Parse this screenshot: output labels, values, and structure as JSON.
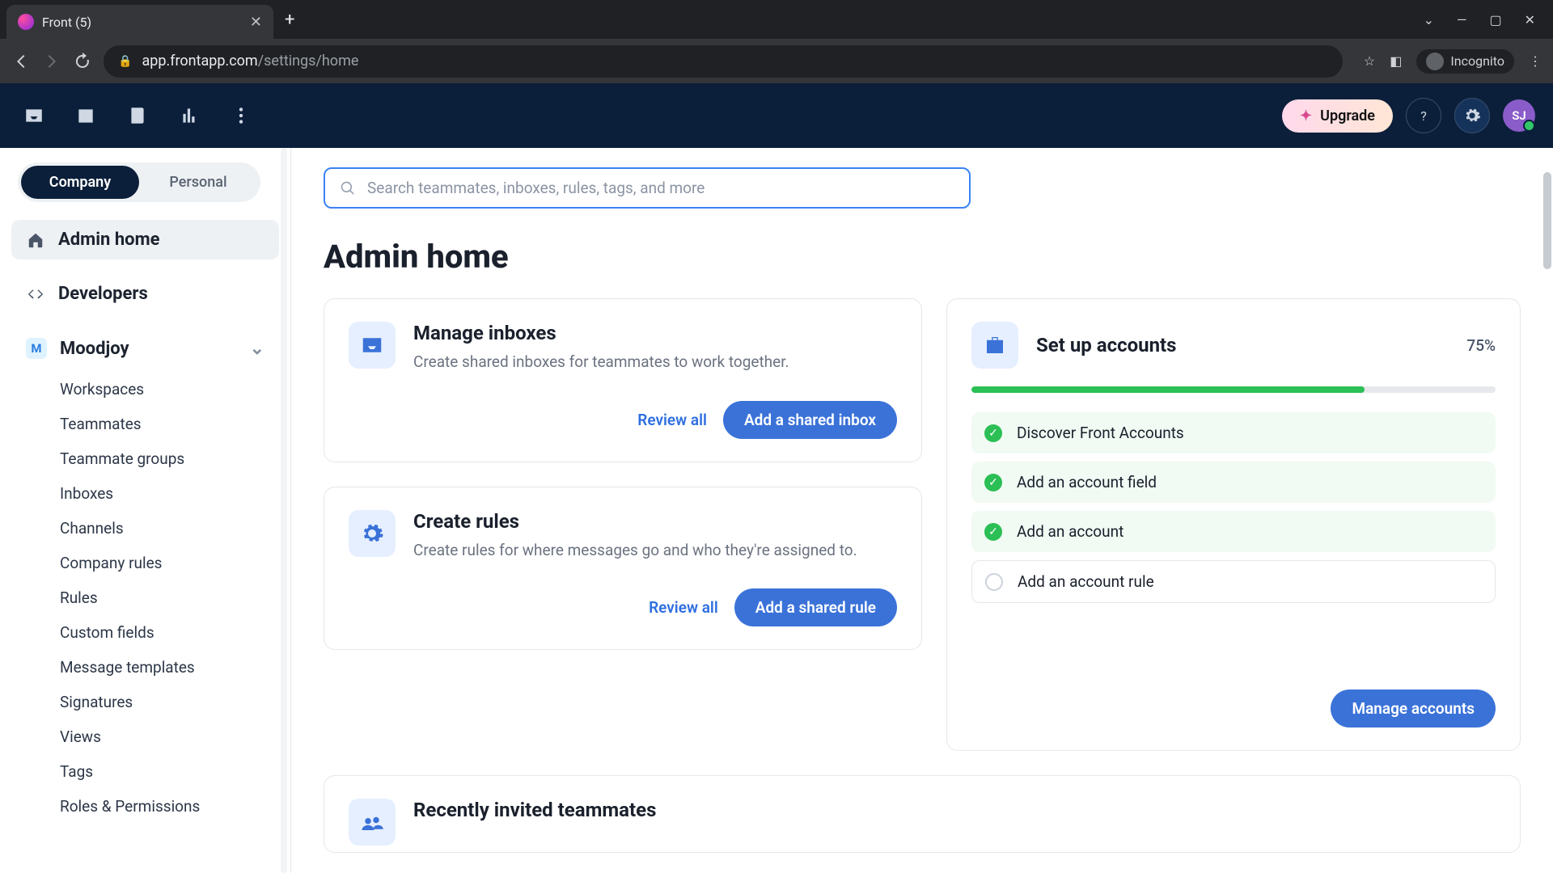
{
  "browser": {
    "tab_title": "Front (5)",
    "url_domain": "app.frontapp.com",
    "url_path": "/settings/home",
    "incognito_label": "Incognito"
  },
  "topbar": {
    "upgrade_label": "Upgrade",
    "avatar_initials": "SJ"
  },
  "sidebar": {
    "tab_company": "Company",
    "tab_personal": "Personal",
    "admin_home": "Admin home",
    "developers": "Developers",
    "workspace_badge": "M",
    "workspace_name": "Moodjoy",
    "items": [
      "Workspaces",
      "Teammates",
      "Teammate groups",
      "Inboxes",
      "Channels",
      "Company rules",
      "Rules",
      "Custom fields",
      "Message templates",
      "Signatures",
      "Views",
      "Tags",
      "Roles & Permissions"
    ]
  },
  "search": {
    "placeholder": "Search teammates, inboxes, rules, tags, and more"
  },
  "page": {
    "title": "Admin home"
  },
  "card_inboxes": {
    "title": "Manage inboxes",
    "desc": "Create shared inboxes for teammates to work together.",
    "review": "Review all",
    "primary": "Add a shared inbox"
  },
  "card_rules": {
    "title": "Create rules",
    "desc": "Create rules for where messages go and who they're assigned to.",
    "review": "Review all",
    "primary": "Add a shared rule"
  },
  "card_accounts": {
    "title": "Set up accounts",
    "percent_label": "75%",
    "progress_pct": 75,
    "tasks": [
      {
        "label": "Discover Front Accounts",
        "done": true
      },
      {
        "label": "Add an account field",
        "done": true
      },
      {
        "label": "Add an account",
        "done": true
      },
      {
        "label": "Add an account rule",
        "done": false
      }
    ],
    "primary": "Manage accounts"
  },
  "card_recent": {
    "title": "Recently invited teammates"
  }
}
